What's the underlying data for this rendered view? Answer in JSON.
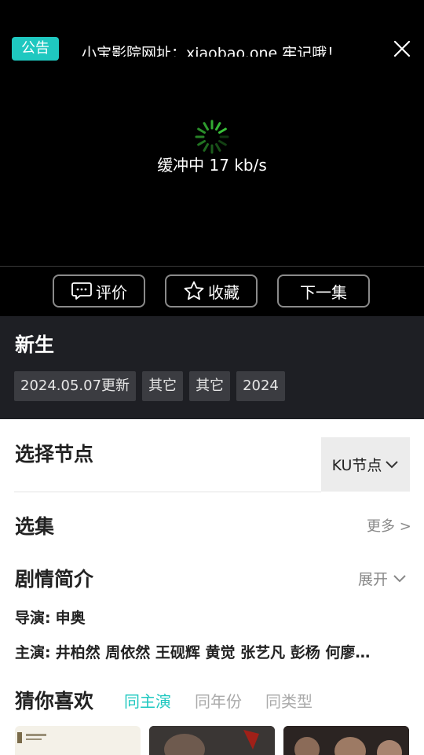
{
  "player": {
    "notice_badge": "公告",
    "notice_text": "小宝影院网址：xiaobao.one 牢记哦！",
    "buffer_text": "缓冲中 17 kb/s",
    "controls": {
      "review_label": "评价",
      "favorite_label": "收藏",
      "next_label": "下一集"
    }
  },
  "info": {
    "title": "新生",
    "tags": [
      "2024.05.07更新",
      "其它",
      "其它",
      "2024"
    ]
  },
  "node": {
    "title": "选择节点",
    "selected": "KU节点"
  },
  "episodes": {
    "title": "选集",
    "more": "更多 >"
  },
  "synopsis": {
    "title": "剧情简介",
    "expand": "展开",
    "director_label": "导演:",
    "director": "申奥",
    "cast_label": "主演:",
    "cast": "井柏然 周依然 王砚辉 黄觉 张艺凡 彭杨 何廖…"
  },
  "recommend": {
    "title": "猜你喜欢",
    "tabs": [
      "同主演",
      "同年份",
      "同类型"
    ]
  },
  "colors": {
    "accent": "#1fc8c0",
    "spinner": "#3ecf3e"
  }
}
